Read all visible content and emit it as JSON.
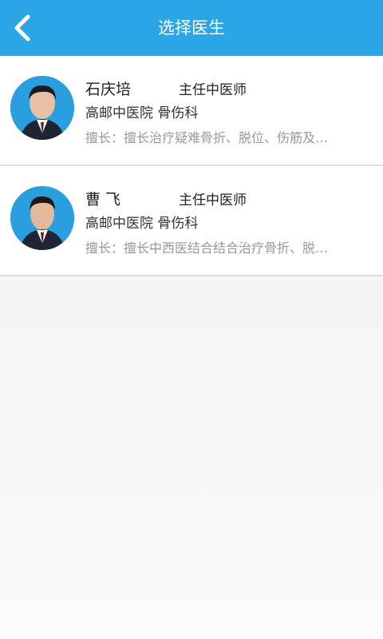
{
  "header": {
    "title": "选择医生"
  },
  "doctors": [
    {
      "name": "石庆培",
      "title": "主任中医师",
      "hospital": "高邮中医院",
      "department": "骨伤科",
      "skill": "擅长：擅长治疗疑难骨折、脱位、伤筋及…"
    },
    {
      "name": "曹 飞",
      "title": "主任中医师",
      "hospital": "高邮中医院",
      "department": "骨伤科",
      "skill": "擅长：擅长中西医结合结合治疗骨折、脱…"
    }
  ],
  "colors": {
    "header": "#2aa5e6",
    "avatar_bg": "#2a9fe0"
  },
  "icons": {
    "back": "chevron-left-icon"
  }
}
